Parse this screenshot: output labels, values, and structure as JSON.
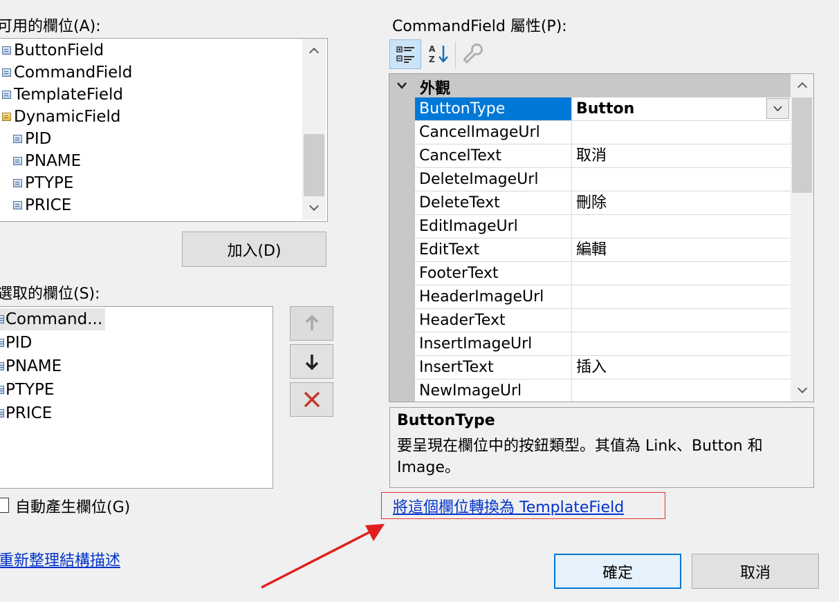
{
  "left": {
    "available_label": "可用的欄位(A):",
    "available_items": [
      {
        "label": "ButtonField",
        "icon": "field-icon"
      },
      {
        "label": "CommandField",
        "icon": "field-icon"
      },
      {
        "label": "TemplateField",
        "icon": "field-icon"
      },
      {
        "label": "DynamicField",
        "icon": "dynamic-field-icon"
      },
      {
        "label": "PID",
        "icon": "bound-field-icon"
      },
      {
        "label": "PNAME",
        "icon": "bound-field-icon"
      },
      {
        "label": "PTYPE",
        "icon": "bound-field-icon"
      },
      {
        "label": "PRICE",
        "icon": "bound-field-icon"
      }
    ],
    "add_button": "加入(D)",
    "selected_label": "選取的欄位(S):",
    "selected_items": [
      {
        "label": "Command...",
        "selected": true
      },
      {
        "label": "PID"
      },
      {
        "label": "PNAME"
      },
      {
        "label": "PTYPE"
      },
      {
        "label": "PRICE"
      }
    ],
    "auto_generate_label": "自動產生欄位(G)",
    "auto_generate_checked": false,
    "refresh_link": "重新整理結構描述"
  },
  "right": {
    "properties_label": "CommandField 屬性(P):",
    "toolbar_icons": [
      "categorized-icon",
      "alphabetical-icon",
      "property-pages-icon"
    ],
    "category": "外觀",
    "properties": [
      {
        "name": "ButtonType",
        "value": "Button",
        "selected": true,
        "dropdown": true
      },
      {
        "name": "CancelImageUrl",
        "value": ""
      },
      {
        "name": "CancelText",
        "value": "取消"
      },
      {
        "name": "DeleteImageUrl",
        "value": ""
      },
      {
        "name": "DeleteText",
        "value": "刪除"
      },
      {
        "name": "EditImageUrl",
        "value": ""
      },
      {
        "name": "EditText",
        "value": "編輯"
      },
      {
        "name": "FooterText",
        "value": ""
      },
      {
        "name": "HeaderImageUrl",
        "value": ""
      },
      {
        "name": "HeaderText",
        "value": ""
      },
      {
        "name": "InsertImageUrl",
        "value": ""
      },
      {
        "name": "InsertText",
        "value": "插入"
      },
      {
        "name": "NewImageUrl",
        "value": ""
      }
    ],
    "description_title": "ButtonType",
    "description_text": "要呈現在欄位中的按鈕類型。其值為 Link、Button 和 Image。",
    "convert_link": "將這個欄位轉換為 TemplateField"
  },
  "dialog": {
    "ok_button": "確定",
    "cancel_button": "取消"
  },
  "annotation": {
    "highlight_color": "#e03030",
    "arrow_color": "#e02020"
  },
  "colors": {
    "selection_blue": "#0078d7",
    "link_blue": "#0033cc"
  }
}
